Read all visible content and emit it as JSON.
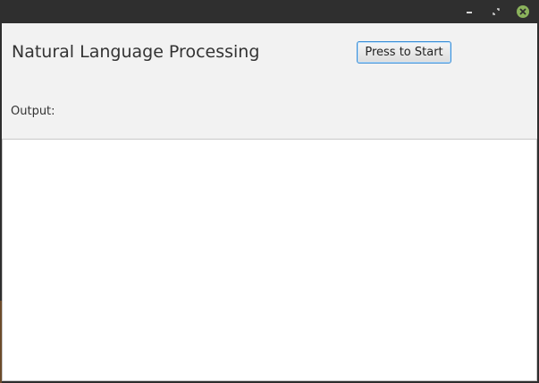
{
  "window": {
    "controls": {
      "minimize_icon": "minimize-icon",
      "maximize_icon": "maximize-icon",
      "close_icon": "close-icon",
      "close_color": "#8bb35c"
    }
  },
  "main": {
    "title": "Natural Language Processing",
    "start_button_label": "Press to Start",
    "output_label": "Output:",
    "output_value": ""
  },
  "colors": {
    "accent": "#3c8fd6",
    "background": "#f2f2f2",
    "titlebar": "#2f2f2f"
  }
}
